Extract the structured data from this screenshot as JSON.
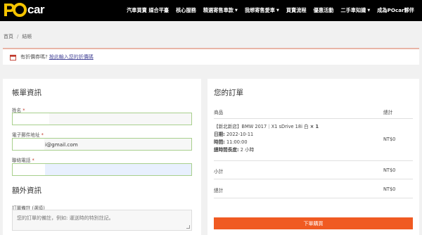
{
  "header": {
    "logo_text": "car",
    "nav": [
      {
        "label": "汽車買賣 媒合平臺",
        "dropdown": false
      },
      {
        "label": "核心服務",
        "dropdown": false
      },
      {
        "label": "精選寄售車款",
        "dropdown": true
      },
      {
        "label": "我想寄售愛車",
        "dropdown": true
      },
      {
        "label": "買賣流程",
        "dropdown": false
      },
      {
        "label": "優惠活動",
        "dropdown": false
      },
      {
        "label": "二手車知識",
        "dropdown": true
      },
      {
        "label": "成為POcar夥伴",
        "dropdown": false
      }
    ]
  },
  "breadcrumb": {
    "home": "首頁",
    "separator": "/",
    "current": "結帳"
  },
  "coupon": {
    "text": "有折價券嗎?",
    "link": "按此輸入您的折價碼"
  },
  "billing": {
    "title": "帳單資訊",
    "name_label": "姓名",
    "email_label": "電子郵件地址",
    "email_value": "i@gmail.com",
    "phone_label": "聯絡電話",
    "required_mark": "*"
  },
  "extra": {
    "title": "額外資訊",
    "notes_label": "訂單備註 (選填)",
    "notes_placeholder": "您的訂單的備註，例如: 運送時的特別註記。"
  },
  "order": {
    "title": "您的訂單",
    "col_product": "商品",
    "col_total": "總計",
    "item_name": "【新北新店】BMW 2017｜X1 sDrive 18i 白",
    "item_qty": "× 1",
    "date_label": "日期:",
    "date_value": "2022-10-11",
    "time_label": "時間:",
    "time_value": "11:00:00",
    "duration_label": "總時間長度:",
    "duration_value": "2 小時",
    "item_total": "NT$0",
    "subtotal_label": "小計",
    "subtotal_value": "NT$0",
    "total_label": "總計",
    "total_value": "NT$0",
    "submit_label": "下單購買"
  },
  "colors": {
    "accent": "#f05a22",
    "logo_yellow": "#f5c400",
    "valid_border": "#a8d08d"
  }
}
